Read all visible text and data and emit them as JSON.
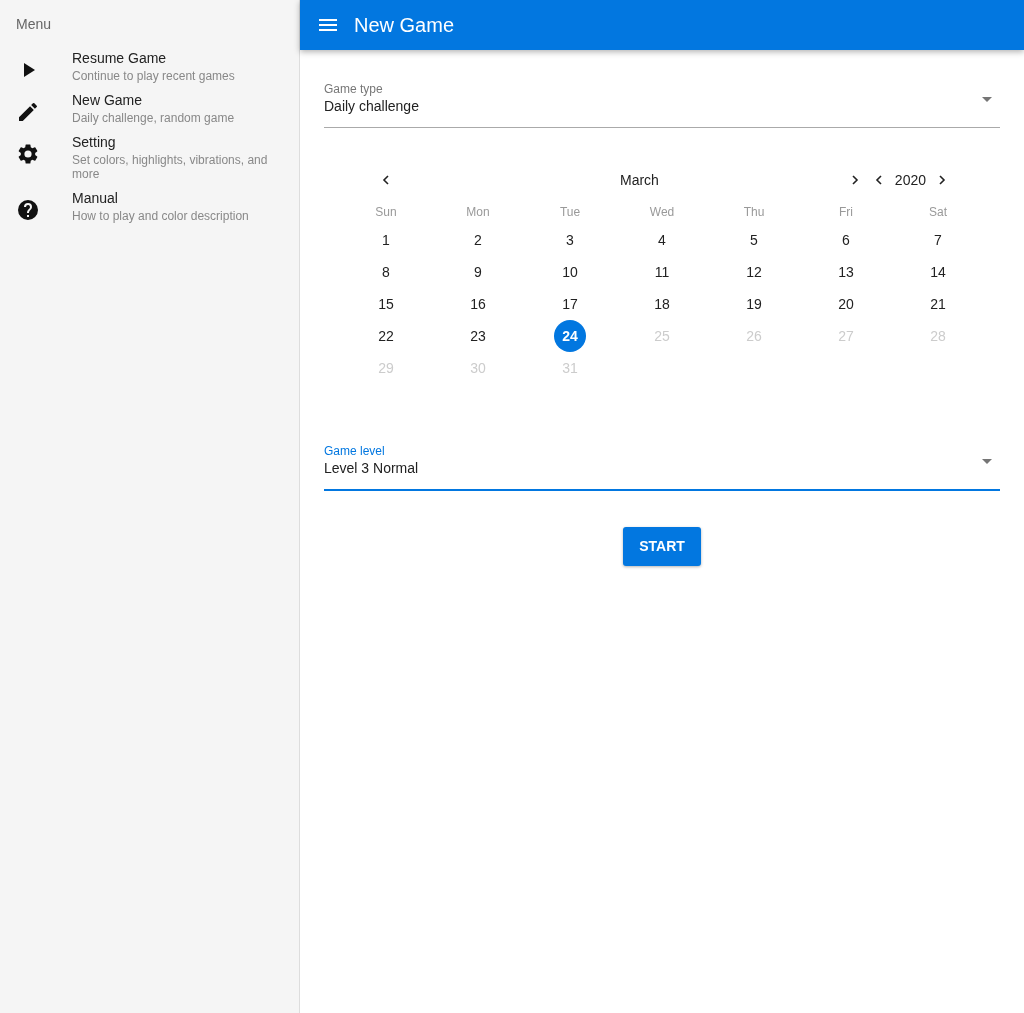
{
  "sidebar": {
    "title": "Menu",
    "items": [
      {
        "kind": "play",
        "title": "Resume Game",
        "subtitle": "Continue to play recent games"
      },
      {
        "kind": "edit",
        "title": "New Game",
        "subtitle": "Daily challenge, random game"
      },
      {
        "kind": "settings",
        "title": "Setting",
        "subtitle": "Set colors, highlights, vibrations, and more"
      },
      {
        "kind": "help",
        "title": "Manual",
        "subtitle": "How to play and color description"
      }
    ]
  },
  "header": {
    "title": "New Game"
  },
  "game_type": {
    "label": "Game type",
    "value": "Daily challenge",
    "focused": false
  },
  "calendar": {
    "month": "March",
    "year": "2020",
    "weekdays": [
      "Sun",
      "Mon",
      "Tue",
      "Wed",
      "Thu",
      "Fri",
      "Sat"
    ],
    "weeks": [
      [
        {
          "label": "1",
          "selected": false,
          "disabled": false
        },
        {
          "label": "2",
          "selected": false,
          "disabled": false
        },
        {
          "label": "3",
          "selected": false,
          "disabled": false
        },
        {
          "label": "4",
          "selected": false,
          "disabled": false
        },
        {
          "label": "5",
          "selected": false,
          "disabled": false
        },
        {
          "label": "6",
          "selected": false,
          "disabled": false
        },
        {
          "label": "7",
          "selected": false,
          "disabled": false
        }
      ],
      [
        {
          "label": "8",
          "selected": false,
          "disabled": false
        },
        {
          "label": "9",
          "selected": false,
          "disabled": false
        },
        {
          "label": "10",
          "selected": false,
          "disabled": false
        },
        {
          "label": "11",
          "selected": false,
          "disabled": false
        },
        {
          "label": "12",
          "selected": false,
          "disabled": false
        },
        {
          "label": "13",
          "selected": false,
          "disabled": false
        },
        {
          "label": "14",
          "selected": false,
          "disabled": false
        }
      ],
      [
        {
          "label": "15",
          "selected": false,
          "disabled": false
        },
        {
          "label": "16",
          "selected": false,
          "disabled": false
        },
        {
          "label": "17",
          "selected": false,
          "disabled": false
        },
        {
          "label": "18",
          "selected": false,
          "disabled": false
        },
        {
          "label": "19",
          "selected": false,
          "disabled": false
        },
        {
          "label": "20",
          "selected": false,
          "disabled": false
        },
        {
          "label": "21",
          "selected": false,
          "disabled": false
        }
      ],
      [
        {
          "label": "22",
          "selected": false,
          "disabled": false
        },
        {
          "label": "23",
          "selected": false,
          "disabled": false
        },
        {
          "label": "24",
          "selected": true,
          "disabled": false
        },
        {
          "label": "25",
          "selected": false,
          "disabled": true
        },
        {
          "label": "26",
          "selected": false,
          "disabled": true
        },
        {
          "label": "27",
          "selected": false,
          "disabled": true
        },
        {
          "label": "28",
          "selected": false,
          "disabled": true
        }
      ],
      [
        {
          "label": "29",
          "selected": false,
          "disabled": true
        },
        {
          "label": "30",
          "selected": false,
          "disabled": true
        },
        {
          "label": "31",
          "selected": false,
          "disabled": true
        }
      ]
    ]
  },
  "game_level": {
    "label": "Game level",
    "value": "Level 3 Normal",
    "focused": true
  },
  "start_button": "START"
}
